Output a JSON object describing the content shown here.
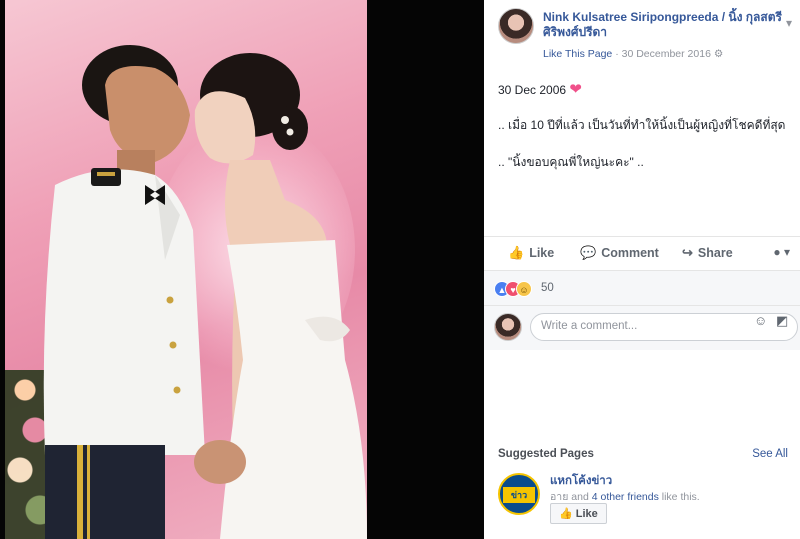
{
  "page": {
    "name": "Nink Kulsatree Siripongpreeda / นิ้ง กุลสตรี ศิริพงศ์ปรีดา",
    "like_this_page": "Like This Page",
    "date": "30 December 2016",
    "separator": "·",
    "settings_glyph": "⚙"
  },
  "post": {
    "line1": "30 Dec 2006",
    "line2": ".. เมื่อ 10 ปีที่แล้ว เป็นวันที่ทำให้นิ้งเป็นผู้หญิงที่โชคดีที่สุด",
    "line3": ".. \"นิ้งขอบคุณพี่ใหญ่นะคะ\" ..",
    "heart": "❤"
  },
  "actions": {
    "like": "Like",
    "comment": "Comment",
    "share": "Share"
  },
  "reactions": {
    "count": "50",
    "like_glyph": "👍",
    "love_glyph": "♥",
    "haha_glyph": "😆"
  },
  "comment": {
    "placeholder": "Write a comment..."
  },
  "suggested": {
    "title": "Suggested Pages",
    "see_all": "See All",
    "page_name": "แหกโค้งข่าว",
    "logo_text": "ข่าว",
    "friends_prefix": "อาย and",
    "friends_link": "4 other friends",
    "friends_suffix": "like this.",
    "like_button": "Like"
  },
  "colors": {
    "link": "#365899",
    "love": "#f0506e",
    "like": "#4a7ff1"
  },
  "icons": {
    "like": "thumbs-up-icon",
    "comment": "speech-bubble-icon",
    "share": "share-arrow-icon",
    "emoji": "smiley-icon",
    "sticker": "sticker-icon",
    "dropdown": "chevron-down-icon"
  }
}
